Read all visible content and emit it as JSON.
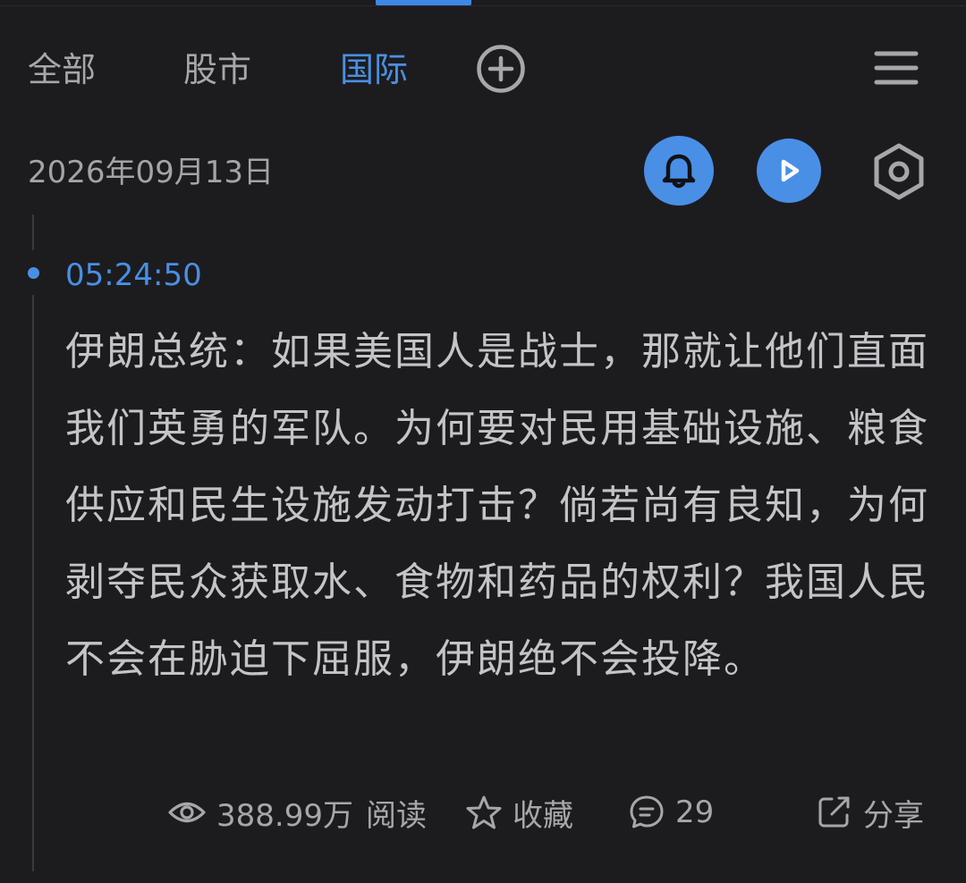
{
  "tabs": [
    {
      "label": "全部",
      "active": false
    },
    {
      "label": "股市",
      "active": false
    },
    {
      "label": "国际",
      "active": true
    }
  ],
  "header": {
    "add_tab_icon": "plus-circle-icon",
    "menu_icon": "hamburger-menu-icon"
  },
  "date": "2026年09月13日",
  "toolbar": {
    "bell_icon": "bell-icon",
    "play_icon": "play-icon",
    "settings_icon": "hexagon-settings-icon"
  },
  "item": {
    "time": "05:24:50",
    "text": "伊朗总统：如果美国人是战士，那就让他们直面我们英勇的军队。为何要对民用基础设施、粮食供应和民生设施发动打击？倘若尚有良知，为何剥夺民众获取水、食物和药品的权利？我国人民不会在胁迫下屈服，伊朗绝不会投降。",
    "views": "388.99万",
    "views_label": "阅读",
    "favorite_label": "收藏",
    "comments": "29",
    "share_label": "分享"
  },
  "colors": {
    "background": "#1c1c1f",
    "accent": "#4a8fe6",
    "text": "#c4c4c8",
    "muted": "#a7a7ab"
  }
}
